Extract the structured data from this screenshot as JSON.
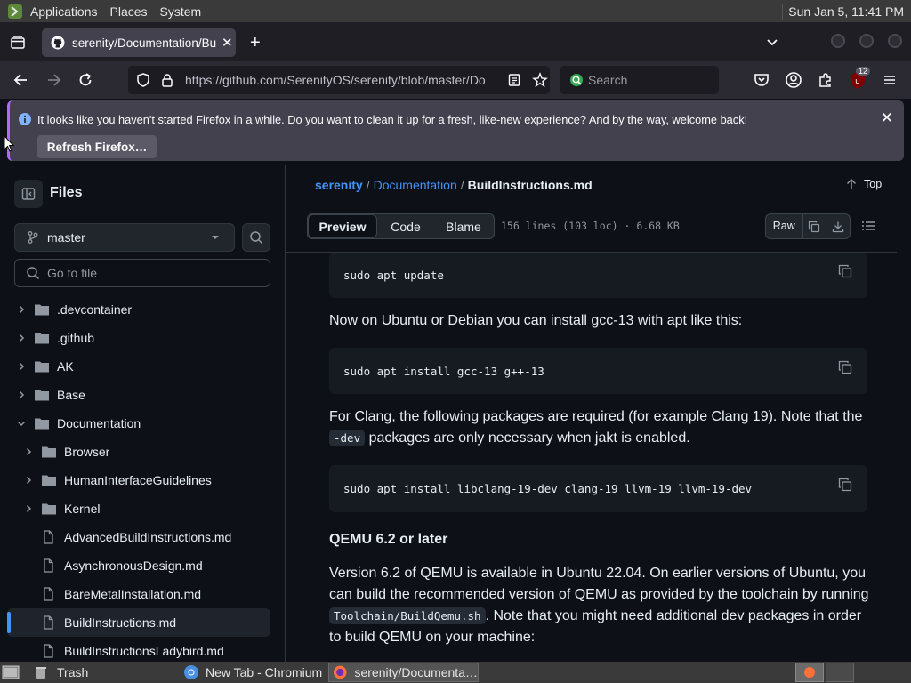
{
  "top_panel": {
    "menus": [
      "Applications",
      "Places",
      "System"
    ],
    "clock": "Sun Jan  5, 11:41 PM"
  },
  "browser": {
    "tab_title": "serenity/Documentation/Bu",
    "url": "https://github.com/SerenityOS/serenity/blob/master/Do",
    "url_host_bold": "github.com",
    "search_placeholder": "Search",
    "badge_count": "12",
    "notification": {
      "message": "It looks like you haven't started Firefox in a while. Do you want to clean it up for a fresh, like-new experience? And by the way, welcome back!",
      "button": "Refresh Firefox…"
    }
  },
  "sidebar": {
    "title": "Files",
    "branch": "master",
    "goto_placeholder": "Go to file",
    "tree": [
      {
        "label": ".devcontainer",
        "type": "folder",
        "level": 0,
        "expanded": false
      },
      {
        "label": ".github",
        "type": "folder",
        "level": 0,
        "expanded": false
      },
      {
        "label": "AK",
        "type": "folder",
        "level": 0,
        "expanded": false
      },
      {
        "label": "Base",
        "type": "folder",
        "level": 0,
        "expanded": false
      },
      {
        "label": "Documentation",
        "type": "folder",
        "level": 0,
        "expanded": true
      },
      {
        "label": "Browser",
        "type": "folder",
        "level": 1,
        "expanded": false
      },
      {
        "label": "HumanInterfaceGuidelines",
        "type": "folder",
        "level": 1,
        "expanded": false
      },
      {
        "label": "Kernel",
        "type": "folder",
        "level": 1,
        "expanded": false
      },
      {
        "label": "AdvancedBuildInstructions.md",
        "type": "file",
        "level": 1
      },
      {
        "label": "AsynchronousDesign.md",
        "type": "file",
        "level": 1
      },
      {
        "label": "BareMetalInstallation.md",
        "type": "file",
        "level": 1
      },
      {
        "label": "BuildInstructions.md",
        "type": "file",
        "level": 1,
        "selected": true
      },
      {
        "label": "BuildInstructionsLadybird.md",
        "type": "file",
        "level": 1
      }
    ]
  },
  "file_view": {
    "breadcrumb": {
      "repo": "serenity",
      "sep1": "/",
      "dir": "Documentation",
      "sep2": "/",
      "file": "BuildInstructions.md"
    },
    "top_label": "Top",
    "tabs": {
      "preview": "Preview",
      "code": "Code",
      "blame": "Blame"
    },
    "meta": "156 lines (103 loc) · 6.68 KB",
    "raw_label": "Raw"
  },
  "doc": {
    "code1": "sudo apt update",
    "p1": "Now on Ubuntu or Debian you can install gcc-13 with apt like this:",
    "code2": "sudo apt install gcc-13 g++-13",
    "p2_a": "For Clang, the following packages are required (for example Clang 19). Note that the",
    "p2_code": "-dev",
    "p2_b": "packages are only necessary when jakt is enabled.",
    "code3": "sudo apt install libclang-19-dev clang-19 llvm-19 llvm-19-dev",
    "h_qemu": "QEMU 6.2 or later",
    "p3_a": "Version 6.2 of QEMU is available in Ubuntu 22.04. On earlier versions of Ubuntu, you can build the recommended version of QEMU as provided by the toolchain by running",
    "p3_code": "Toolchain/BuildQemu.sh",
    "p3_b": ". Note that you might need additional dev packages in order to build QEMU on your machine:"
  },
  "taskbar": {
    "items": [
      "Trash",
      "New Tab - Chromium",
      "serenity/Documenta…"
    ]
  }
}
